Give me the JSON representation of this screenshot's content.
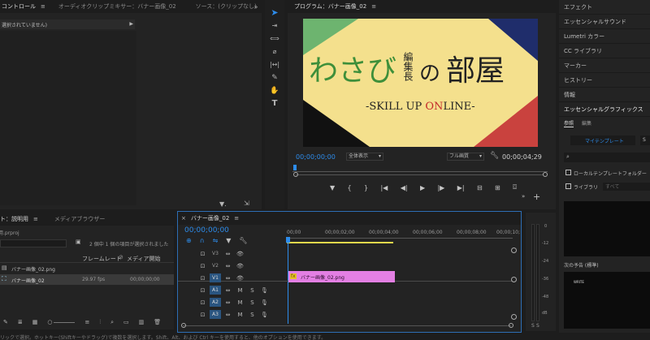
{
  "left_panel": {
    "tabs": [
      "コントロール",
      "オーディオクリップミキサー：バナー画像_02",
      "ソース：(クリップなし)",
      "Lu"
    ],
    "overflow_icon": "double-chevron-right-icon",
    "placeholder_text": "選択されていません)"
  },
  "program": {
    "tab_label": "プログラム：バナー画像_02",
    "timecode": "00;00;00;00",
    "zoom": "全体表示",
    "quality": "フル画質",
    "duration": "00;00;04;29"
  },
  "banner": {
    "title_left": "わさび",
    "title_vertical": "編集長",
    "title_mid": "の",
    "title_right": "部屋",
    "tagline_a": "-SKILL UP ",
    "tagline_on": "ON",
    "tagline_b": "LINE-",
    "colors": {
      "bg": "#f4e08d",
      "green": "#6db46f",
      "navy": "#1f2d6b",
      "black": "#111111",
      "red": "#c9423e",
      "accent": "#c42c2c"
    }
  },
  "project": {
    "tabs": [
      "ト：説明用",
      "メディアブラウザー"
    ],
    "file": "説明用.prproj",
    "selection": "2 個中 1 個の項目が選択されました",
    "col_rate": "フレームレート",
    "col_start": "メディア開始",
    "items": [
      {
        "name": "バナー画像_02.png",
        "rate": "",
        "start": ""
      },
      {
        "name": "バナー画像_02",
        "rate": "29.97 fps",
        "start": "00;00;00;00"
      }
    ]
  },
  "timeline": {
    "tab_label": "バナー画像_02",
    "timecode": "00;00;00;00",
    "ruler": [
      "00;00",
      "00;00;02;00",
      "00;00;04;00",
      "00;00;06;00",
      "00;00;08;00",
      "00;00;10;"
    ],
    "tracks": [
      {
        "name": "V3",
        "type": "v"
      },
      {
        "name": "V2",
        "type": "v"
      },
      {
        "name": "V1",
        "type": "v1"
      },
      {
        "name": "A1",
        "type": "a"
      },
      {
        "name": "A2",
        "type": "a"
      },
      {
        "name": "A3",
        "type": "a"
      }
    ],
    "clip_label": "バナー画像_02.png",
    "clip_color": "#e37fe3"
  },
  "meter": {
    "labels": [
      "0",
      "-12",
      "-24",
      "-36",
      "-48",
      "dB"
    ]
  },
  "right_panel": {
    "items": [
      "エフェクト",
      "エッセンシャルサウンド",
      "Lumetri カラー",
      "CC ライブラリ",
      "マーカー",
      "ヒストリー",
      "情報",
      "エッセンシャルグラフィックス"
    ],
    "subtabs": [
      "参照",
      "編集"
    ],
    "my_templates": "マイテンプレート",
    "local_folder": "ローカルテンプレートフォルダー",
    "library": "ライブラリ",
    "library_value": "すべて",
    "next_label": "次の予告 (標準)",
    "thumb_text": "WRITE",
    "cut_char": "S"
  },
  "status_bar": {
    "text": "リックで選択。ホットキー(Shiftキーやドラッグ)で複数を選択します。Shift、Alt、および Ctrl キーを使用すると、他のオプションを使用できます。"
  }
}
